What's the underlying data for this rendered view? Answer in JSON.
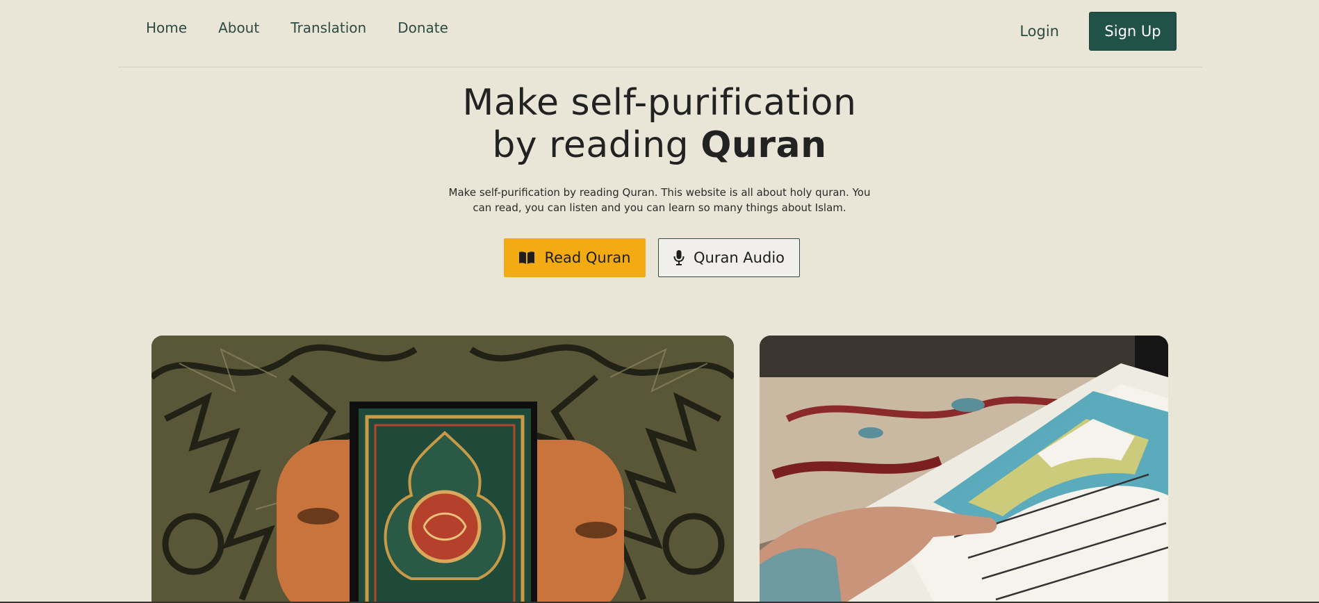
{
  "nav": {
    "links": [
      "Home",
      "About",
      "Translation",
      "Donate"
    ],
    "login": "Login",
    "signup": "Sign Up"
  },
  "hero": {
    "title_line1": "Make self-purification",
    "title_line2_prefix": "by reading ",
    "title_line2_bold": "Quran",
    "description": "Make self-purification by reading Quran. This website is all about holy quran. You can read, you can listen and you can learn so many things about Islam."
  },
  "buttons": {
    "read": {
      "label": "Read Quran",
      "icon": "open-book-icon",
      "color": "#f2ab13"
    },
    "audio": {
      "label": "Quran Audio",
      "icon": "microphone-icon"
    }
  },
  "photos": {
    "left": "quran-book-on-rug-photo",
    "right": "reading-quran-pages-photo"
  },
  "colors": {
    "background": "#e9e5d7",
    "brand_green": "#21524a",
    "accent_yellow": "#f2ab13"
  }
}
